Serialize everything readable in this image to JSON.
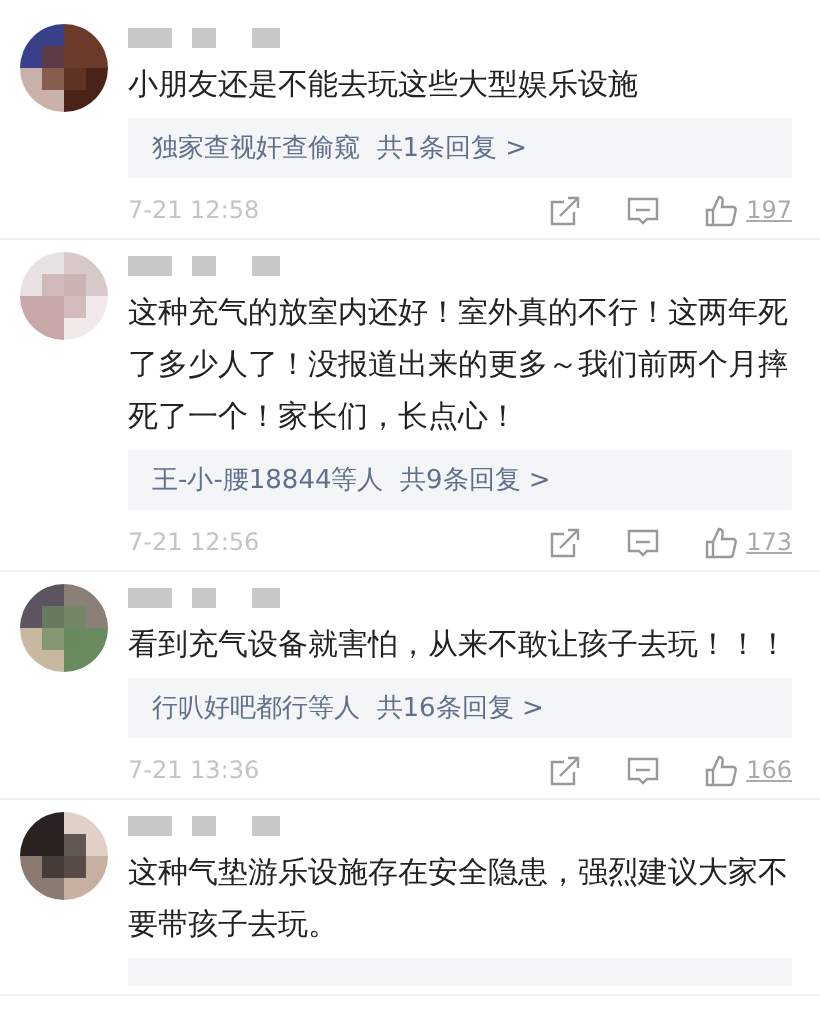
{
  "comments": [
    {
      "text": "小朋友还是不能去玩这些大型娱乐设施",
      "replies": "独家查视奸查偷窥  共1条回复 >",
      "time": "7-21 12:58",
      "likes": "197"
    },
    {
      "text": "这种充气的放室内还好！室外真的不行！这两年死了多少人了！没报道出来的更多～我们前两个月摔死了一个！家长们，长点心！",
      "replies": "王-小-腰18844等人  共9条回复 >",
      "time": "7-21 12:56",
      "likes": "173"
    },
    {
      "text": "看到充气设备就害怕，从来不敢让孩子去玩！！！",
      "replies": "行叭好吧都行等人  共16条回复 >",
      "time": "7-21 13:36",
      "likes": "166"
    },
    {
      "text": "这种气垫游乐设施存在安全隐患，强烈建议大家不要带孩子去玩。",
      "reply_box_cut": true
    }
  ]
}
